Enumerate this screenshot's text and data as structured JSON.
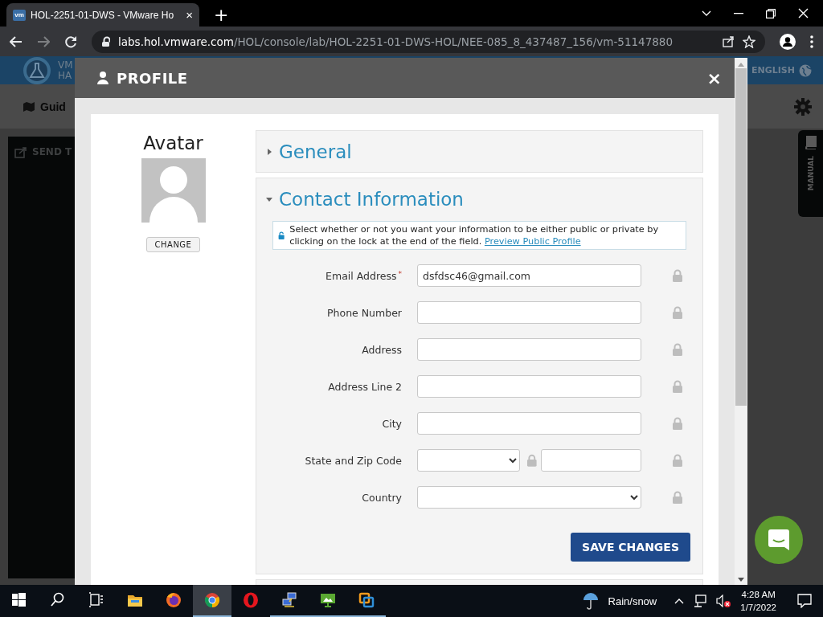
{
  "browser": {
    "tab": {
      "favicon_text": "vm",
      "title": "HOL-2251-01-DWS - VMware Ho",
      "close": "×"
    },
    "new_tab": "+",
    "url_host": "labs.hol.vmware.com",
    "url_path": "/HOL/console/lab/HOL-2251-01-DWS-HOL/NEE-085_8_437487_156/vm-51147880"
  },
  "background_page": {
    "logo_lines": [
      "VM",
      "HA"
    ],
    "language": "ENGLISH",
    "guide": "Guid",
    "send": "SEND T",
    "manual": "MANUAL"
  },
  "modal": {
    "title": "PROFILE",
    "close": "×",
    "avatar": {
      "heading": "Avatar",
      "button": "CHANGE"
    },
    "sections": [
      {
        "title": "General",
        "expanded": false
      },
      {
        "title": "Contact Information",
        "expanded": true
      }
    ],
    "notice": {
      "locked": false,
      "text": "Select whether or not you want your information to be either public or private by clicking on the lock at the end of the field.",
      "link": "Preview Public Profile"
    },
    "fields": [
      {
        "kind": "text",
        "label": "Email Address",
        "required_mark": "*",
        "value": "dsfdsc46@gmail.com",
        "locked": true
      },
      {
        "kind": "text",
        "label": "Phone Number",
        "locked": true
      },
      {
        "kind": "text",
        "label": "Address",
        "locked": true
      },
      {
        "kind": "text",
        "label": "Address Line 2",
        "locked": true
      },
      {
        "kind": "text",
        "label": "City",
        "locked": true
      },
      {
        "kind": "state-zip",
        "label": "State and Zip Code",
        "locked": true,
        "inner_locked": true
      },
      {
        "kind": "select",
        "label": "Country",
        "locked": true
      }
    ],
    "save_button": "SAVE CHANGES"
  },
  "taskbar": {
    "apps": [
      {
        "kind": "start",
        "selected": false,
        "running": false
      },
      {
        "kind": "search",
        "selected": false,
        "running": false
      },
      {
        "kind": "taskview",
        "selected": false,
        "running": false
      },
      {
        "kind": "folder",
        "selected": false,
        "running": false
      },
      {
        "kind": "firefox",
        "selected": false,
        "running": false
      },
      {
        "kind": "chrome",
        "selected": true,
        "running": true
      },
      {
        "kind": "opera",
        "selected": false,
        "running": false
      },
      {
        "kind": "network",
        "selected": false,
        "running": true
      },
      {
        "kind": "remote",
        "selected": false,
        "running": true
      },
      {
        "kind": "vmware",
        "selected": false,
        "running": true
      }
    ],
    "weather": "Rain/snow",
    "time": "4:28 AM",
    "date": "1/7/2022"
  }
}
